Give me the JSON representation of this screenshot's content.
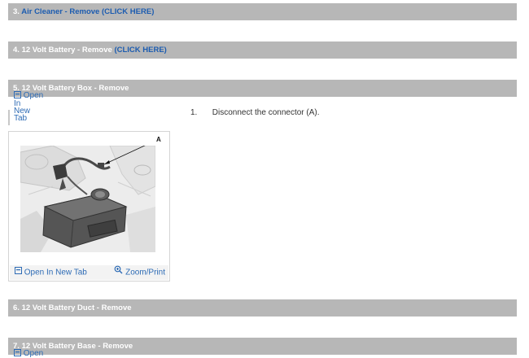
{
  "sections": [
    {
      "number": "3.",
      "title": "Air Cleaner - Remove",
      "link_label": "(CLICK HERE)"
    },
    {
      "number": "4.",
      "title": "12 Volt Battery - Remove",
      "link_label": "(CLICK HERE)"
    },
    {
      "number": "5.",
      "title": "12 Volt Battery Box - Remove",
      "link_label": ""
    },
    {
      "number": "6.",
      "title": "12 Volt Battery Duct - Remove",
      "link_label": ""
    },
    {
      "number": "7.",
      "title": "12 Volt Battery Base - Remove",
      "link_label": ""
    }
  ],
  "open_link": {
    "line1": "Open",
    "line2": "In",
    "line3": "New",
    "line4": "Tab"
  },
  "open_link_bottom": {
    "line1": "Open"
  },
  "step": {
    "number": "1.",
    "text": "Disconnect the connector (A)."
  },
  "figure": {
    "callout_label": "A",
    "open_label": "Open In New Tab",
    "zoom_label": "Zoom/Print"
  },
  "icons": {
    "open": "open-in-new-tab-icon",
    "zoom": "zoom-icon"
  },
  "colors": {
    "bar": "#b7b7b7",
    "link": "#2d6bb5",
    "bar_link": "#1c5cb0"
  }
}
